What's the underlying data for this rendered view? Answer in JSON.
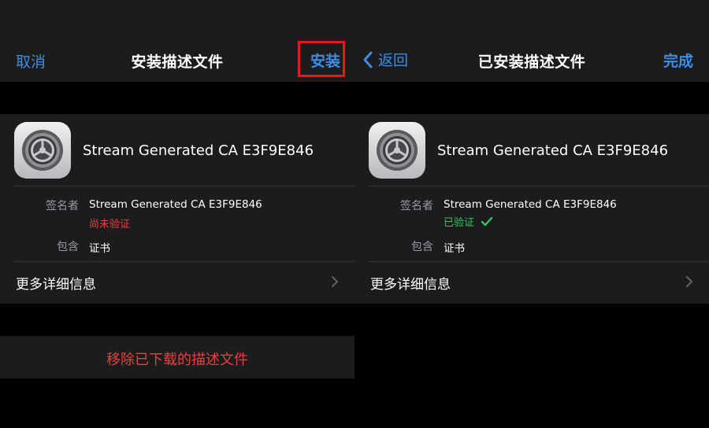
{
  "left": {
    "nav": {
      "cancel": "取消",
      "title": "安装描述文件",
      "install": "安装"
    },
    "profile": {
      "name": "Stream Generated CA E3F9E846",
      "signer_label": "签名者",
      "signer_value": "Stream Generated CA E3F9E846",
      "status": "尚未验证",
      "contains_label": "包含",
      "contains_value": "证书",
      "more_info": "更多详细信息"
    },
    "remove_button": "移除已下载的描述文件"
  },
  "right": {
    "nav": {
      "back": "返回",
      "title": "已安装描述文件",
      "done": "完成"
    },
    "profile": {
      "name": "Stream Generated CA E3F9E846",
      "signer_label": "签名者",
      "signer_value": "Stream Generated CA E3F9E846",
      "status": "已验证",
      "contains_label": "包含",
      "contains_value": "证书",
      "more_info": "更多详细信息"
    }
  },
  "colors": {
    "accent": "#3a8ee6",
    "danger": "#e8413b",
    "verified": "#33c759",
    "highlight": "#e21b1b"
  },
  "icons": [
    "settings-gear-icon",
    "chevron-right-icon",
    "chevron-left-icon",
    "checkmark-icon"
  ]
}
